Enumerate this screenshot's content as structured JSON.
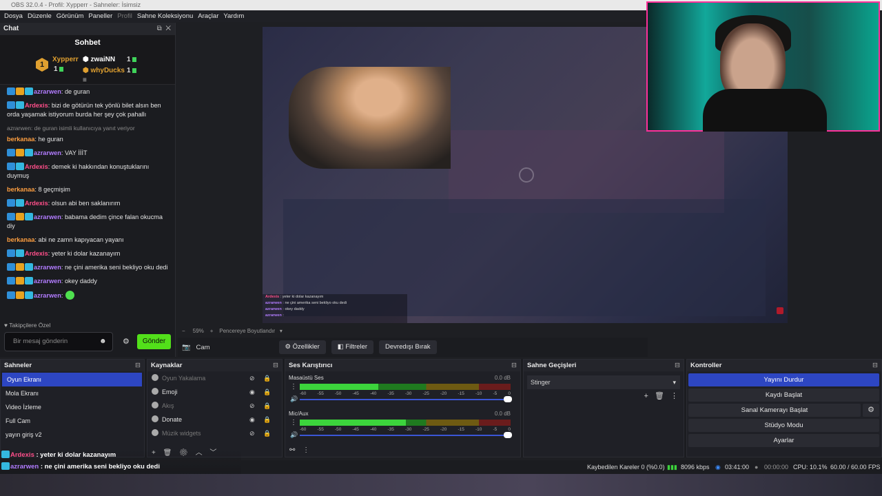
{
  "window": {
    "title": "OBS 32.0.4 - Profil: Xypperr - Sahneler: İsimsiz"
  },
  "menu": [
    {
      "label": "Dosya",
      "enabled": true
    },
    {
      "label": "Düzenle",
      "enabled": true
    },
    {
      "label": "Görünüm",
      "enabled": true
    },
    {
      "label": "Paneller",
      "enabled": true
    },
    {
      "label": "Profil",
      "enabled": false
    },
    {
      "label": "Sahne Koleksiyonu",
      "enabled": true
    },
    {
      "label": "Araçlar",
      "enabled": true
    },
    {
      "label": "Yardım",
      "enabled": true
    }
  ],
  "chat_dock": {
    "title": "Chat",
    "header": "Sohbet",
    "leaderboard": [
      {
        "rank": "1",
        "name": "Xypperr",
        "count": "1",
        "color": "#e0a030"
      },
      {
        "name": "zwaiNN",
        "count": "1",
        "color": "#ffffff"
      },
      {
        "name": "whyDucks",
        "count": "1",
        "color": "#e0a030"
      }
    ],
    "messages": [
      {
        "user": "azrarwen",
        "color": "#b27cff",
        "text": ": de guran"
      },
      {
        "user": "Ardexis",
        "color": "#ff4f8a",
        "text": ": bizi de götürün tek yönlü bilet alsın ben orda yaşamak istiyorum burda her şey çok pahallı"
      },
      {
        "reply": "azrarwen: de guran isimli kullanıcıya yanıt veriyor",
        "user": "berkanaa",
        "color": "#ff9f40",
        "text": ": he guran"
      },
      {
        "user": "azrarwen",
        "color": "#b27cff",
        "text": ": VAY İİİT"
      },
      {
        "user": "Ardexis",
        "color": "#ff4f8a",
        "text": ": demek ki hakkından konuştuklarını duymuş"
      },
      {
        "user": "berkanaa",
        "color": "#ff9f40",
        "text": ": 8 geçmişim"
      },
      {
        "user": "Ardexis",
        "color": "#ff4f8a",
        "text": ": olsun abi ben saklanırım"
      },
      {
        "user": "azrarwen",
        "color": "#b27cff",
        "text": ": babama dedim çince falan okucma diy"
      },
      {
        "user": "berkanaa",
        "color": "#ff9f40",
        "text": ": abi ne zamn kapıyacan yayanı"
      },
      {
        "user": "Ardexis",
        "color": "#ff4f8a",
        "text": ": yeter ki dolar kazanayım"
      },
      {
        "user": "azrarwen",
        "color": "#b27cff",
        "text": ": ne çini amerika seni bekliyo oku dedi"
      },
      {
        "user": "azrarwen",
        "color": "#b27cff",
        "text": ": okey daddy"
      },
      {
        "user": "azrarwen",
        "color": "#b27cff",
        "text": ":"
      }
    ],
    "followers_only": "Takipçilere Özel",
    "input_placeholder": "Bir mesaj gönderin",
    "send_label": "Gönder"
  },
  "preview": {
    "zoom": "59%",
    "fit_label": "Pencereye Boyutlandır",
    "overlay_chat": [
      {
        "user": "Ardexis",
        "text": " : yeter ki dolar kazanayım"
      },
      {
        "user": "azrarwen",
        "text": " : ne çini amerika seni bekliyo oku dedi"
      },
      {
        "user": "azrarwen",
        "text": " : okey daddy"
      },
      {
        "user": "azrarwen",
        "text": " :"
      }
    ]
  },
  "source_toolbar": {
    "source_name": "Cam",
    "properties": "Özellikler",
    "filters": "Filtreler",
    "deactivate": "Devredışı Bırak"
  },
  "scenes": {
    "title": "Sahneler",
    "items": [
      "Oyun Ekranı",
      "Mola Ekranı",
      "Video İzleme",
      "Full Cam",
      "yayın giriş v2"
    ],
    "selected": "Oyun Ekranı"
  },
  "sources": {
    "title": "Kaynaklar",
    "items": [
      {
        "name": "Oyun Yakalama",
        "visible": false
      },
      {
        "name": "Emoji",
        "visible": true
      },
      {
        "name": "Akış",
        "visible": false
      },
      {
        "name": "Donate",
        "visible": true
      },
      {
        "name": "Müzik widgets",
        "visible": false
      }
    ]
  },
  "mixer": {
    "title": "Ses Karıştırıcı",
    "channels": [
      {
        "name": "Masaüstü Ses",
        "db": "0.0 dB",
        "level": 0.62
      },
      {
        "name": "Mic/Aux",
        "db": "0.0 dB",
        "level": 0.84
      }
    ],
    "ticks": [
      "-60",
      "-55",
      "-50",
      "-45",
      "-40",
      "-35",
      "-30",
      "-25",
      "-20",
      "-15",
      "-10",
      "-5",
      "0"
    ]
  },
  "transitions": {
    "title": "Sahne Geçişleri",
    "selected": "Stinger"
  },
  "controls": {
    "title": "Kontroller",
    "buttons": [
      "Yayını Durdur",
      "Kaydı Başlat",
      "Sanal Kamerayı Başlat",
      "Stüdyo Modu",
      "Ayarlar"
    ]
  },
  "status": {
    "dropped": "Kaybedilen Kareler 0 (%0.0)",
    "bitrate": "8096 kbps",
    "stream_time": "03:41:00",
    "rec_time": "00:00:00",
    "cpu": "CPU: 10.1%",
    "fps": "60.00 / 60.00 FPS"
  },
  "colors": {
    "accent": "#2d46c2",
    "send": "#52e01a",
    "webcam_border": "#ff2f9a"
  }
}
